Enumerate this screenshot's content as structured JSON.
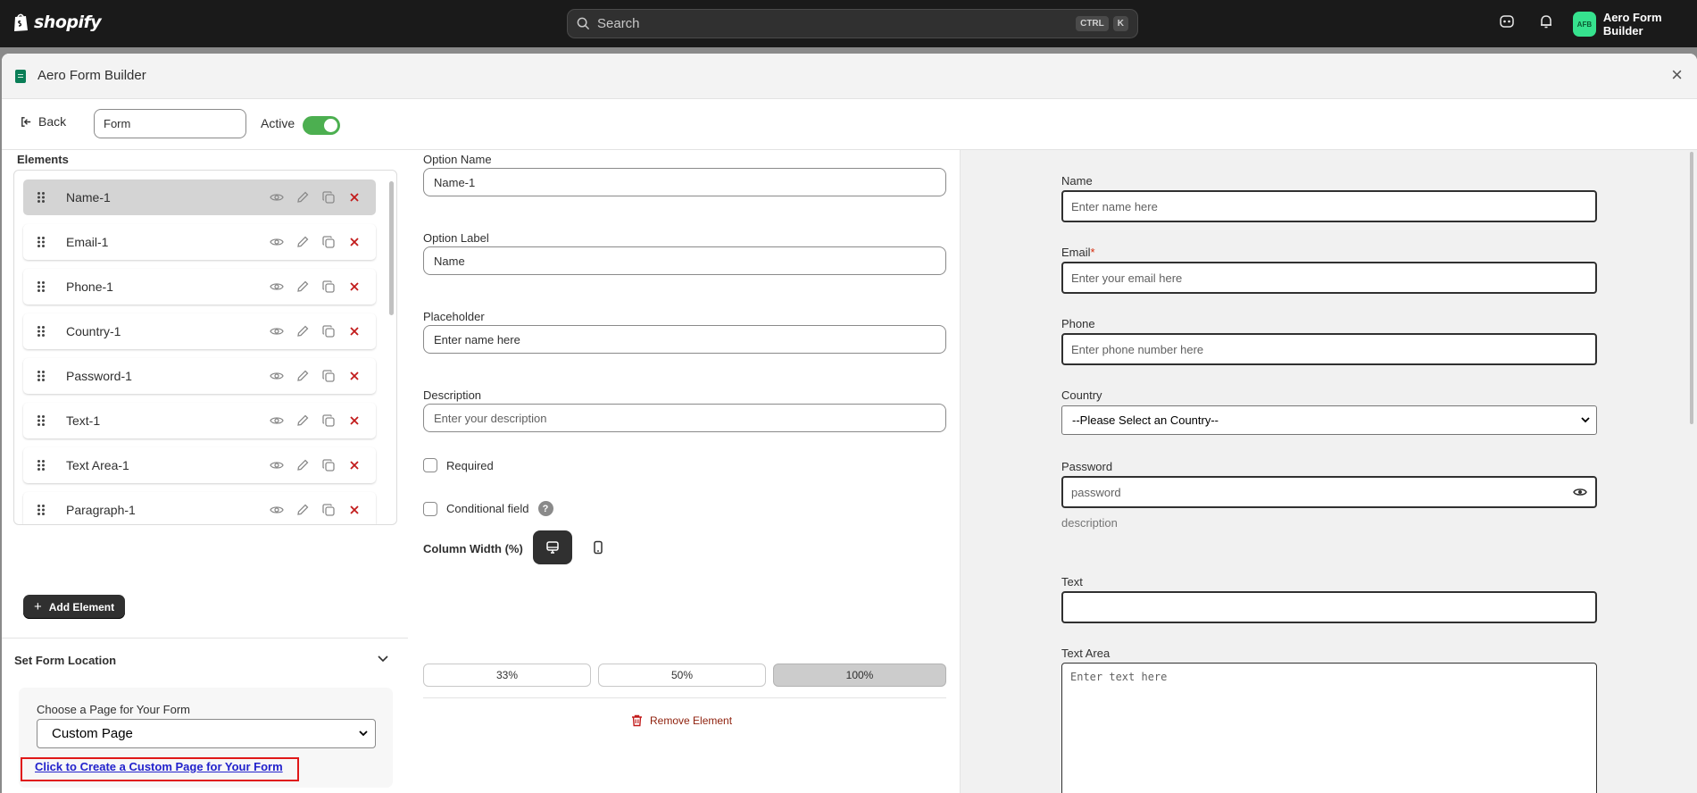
{
  "topbar": {
    "logo_text": "shopify",
    "search_placeholder": "Search",
    "shortcut_keys": [
      "CTRL",
      "K"
    ],
    "avatar_initials": "AFB",
    "store_name": "Aero Form Builder"
  },
  "modal": {
    "title": "Aero Form Builder"
  },
  "toolbar": {
    "back_label": "Back",
    "form_name_value": "Form",
    "active_label": "Active",
    "active_on": true
  },
  "elements": {
    "title": "Elements",
    "items": [
      {
        "label": "Name-1",
        "selected": true
      },
      {
        "label": "Email-1",
        "selected": false
      },
      {
        "label": "Phone-1",
        "selected": false
      },
      {
        "label": "Country-1",
        "selected": false
      },
      {
        "label": "Password-1",
        "selected": false
      },
      {
        "label": "Text-1",
        "selected": false
      },
      {
        "label": "Text Area-1",
        "selected": false
      },
      {
        "label": "Paragraph-1",
        "selected": false
      }
    ],
    "add_button_label": "Add Element"
  },
  "location": {
    "title": "Set Form Location",
    "choose_label": "Choose a Page for Your Form",
    "selected_page": "Custom Page",
    "create_link": "Click to Create a Custom Page for Your Form"
  },
  "editor": {
    "option_name_label": "Option Name",
    "option_name_value": "Name-1",
    "option_label_label": "Option Label",
    "option_label_value": "Name",
    "placeholder_label": "Placeholder",
    "placeholder_value": "Enter name here",
    "description_label": "Description",
    "description_placeholder": "Enter your description",
    "required_label": "Required",
    "required_checked": false,
    "conditional_label": "Conditional field",
    "conditional_checked": false,
    "help_glyph": "?",
    "column_width_label": "Column Width (%)",
    "width_options": [
      "33%",
      "50%",
      "100%"
    ],
    "selected_width": "100%",
    "selected_device": "desktop",
    "remove_label": "Remove Element"
  },
  "preview": {
    "name_label": "Name",
    "name_placeholder": "Enter name here",
    "email_label": "Email",
    "email_required_mark": "*",
    "email_placeholder": "Enter your email here",
    "phone_label": "Phone",
    "phone_placeholder": "Enter phone number here",
    "country_label": "Country",
    "country_selected": "--Please Select an Country--",
    "password_label": "Password",
    "password_placeholder": "password",
    "password_description": "description",
    "text_label": "Text",
    "textarea_label": "Text Area",
    "textarea_placeholder": "Enter text here"
  },
  "colors": {
    "topbar_bg": "#1a1a1a",
    "toggle_on": "#4caf50",
    "remove_red": "#c21b1b",
    "link_blue": "#2222cc",
    "highlight_box": "#e01818",
    "avatar_green": "#36e28e"
  }
}
